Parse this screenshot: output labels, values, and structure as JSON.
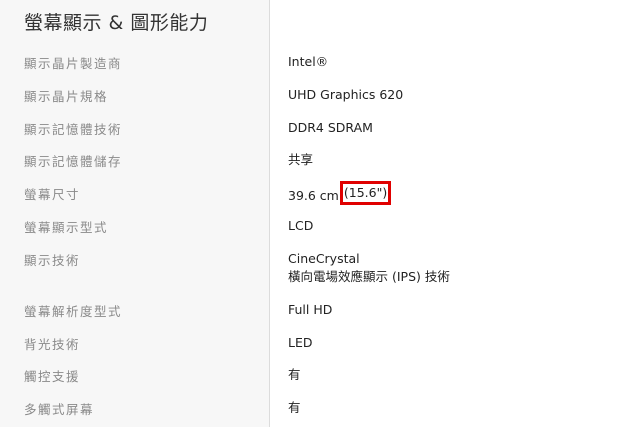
{
  "section": {
    "title": "螢幕顯示 & 圖形能力"
  },
  "specs": [
    {
      "label": "顯示晶片製造商",
      "value": "Intel®"
    },
    {
      "label": "顯示晶片規格",
      "value": "UHD Graphics 620"
    },
    {
      "label": "顯示記憶體技術",
      "value": "DDR4 SDRAM"
    },
    {
      "label": "顯示記憶體儲存",
      "value": "共享"
    },
    {
      "label": "螢幕尺寸",
      "value": "39.6 cm",
      "highlight": "(15.6\")"
    },
    {
      "label": "螢幕顯示型式",
      "value": "LCD"
    },
    {
      "label": "顯示技術",
      "value_lines": [
        "CineCrystal",
        "橫向電場效應顯示 (IPS) 技術"
      ]
    },
    {
      "label": "螢幕解析度型式",
      "value": "Full HD"
    },
    {
      "label": "背光技術",
      "value": "LED"
    },
    {
      "label": "觸控支援",
      "value": "有"
    },
    {
      "label": "多觸式屏幕",
      "value": "有"
    }
  ],
  "colors": {
    "highlight_border": "#e00000",
    "label_text": "#8a8a8a",
    "value_text": "#222222"
  }
}
